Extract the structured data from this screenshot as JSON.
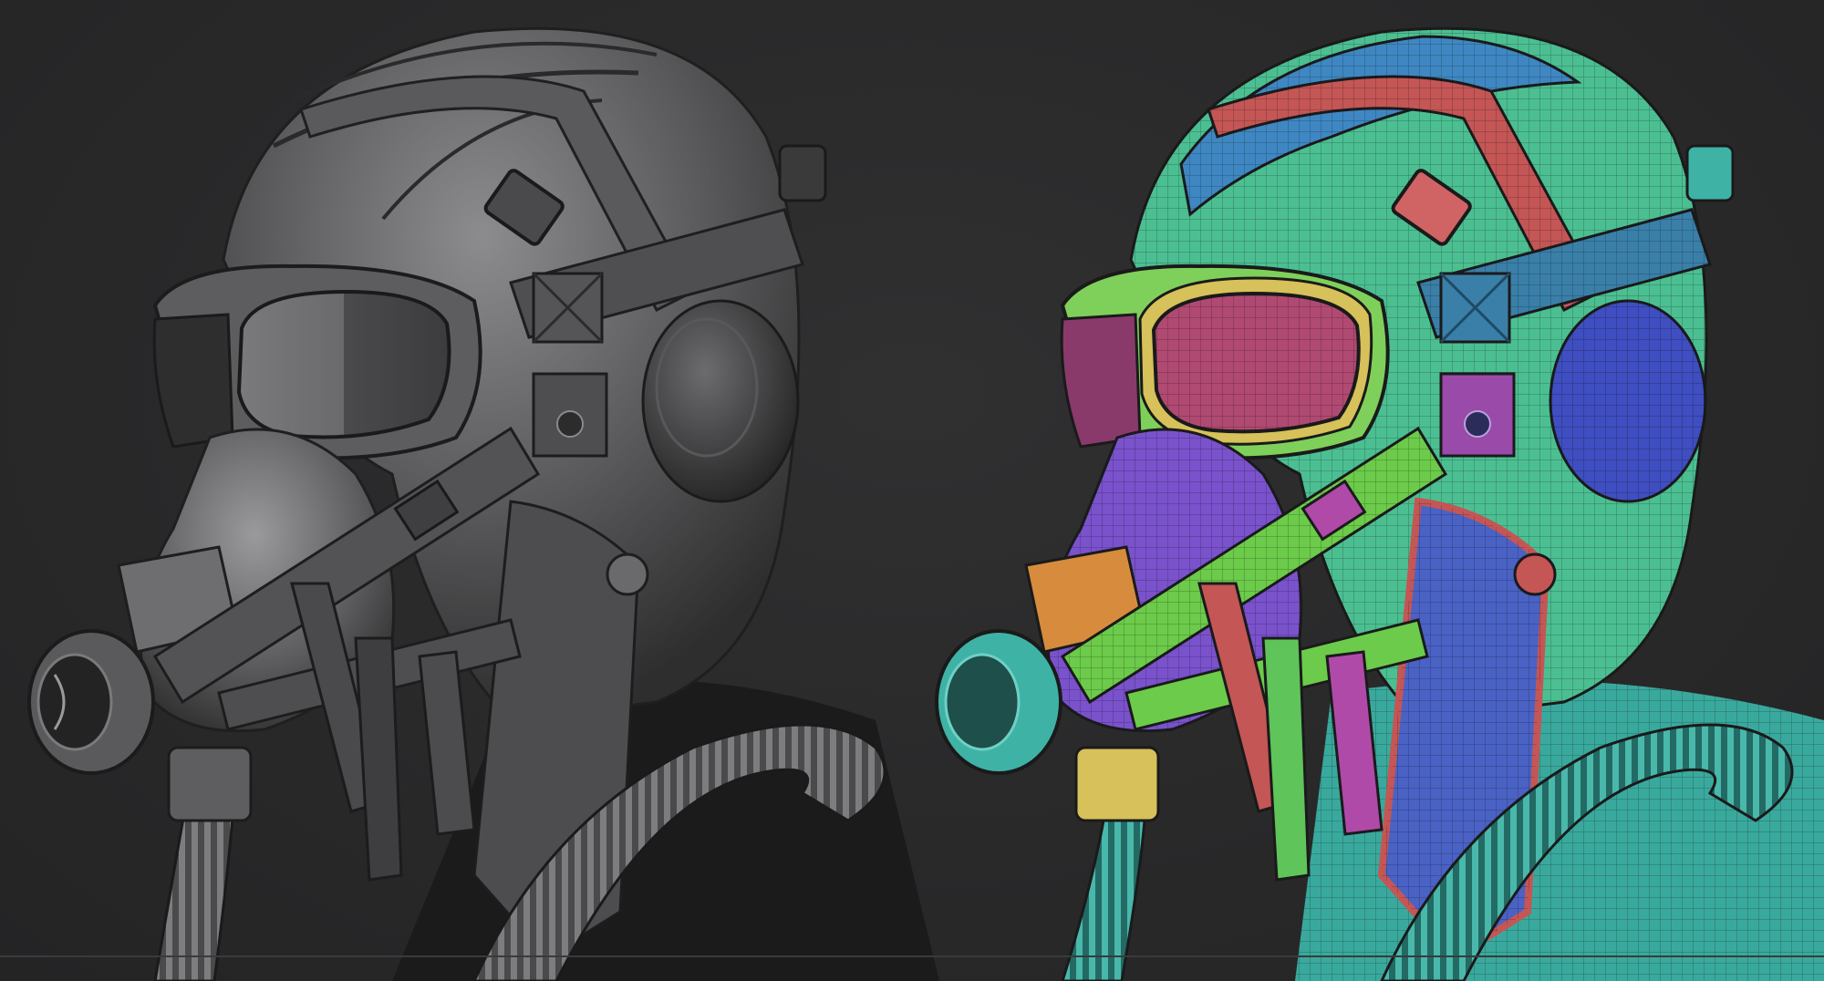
{
  "scene": {
    "background": "#2a2a2b",
    "left_render": {
      "mode": "matcap-gray",
      "subject": "pilot-helmet-gas-mask"
    },
    "right_render": {
      "mode": "polygroups-wireframe",
      "subject": "pilot-helmet-gas-mask"
    }
  },
  "colors": {
    "clay_dark": "#3b3b3c",
    "clay_mid": "#5c5c5e",
    "clay_light": "#8a8a8c",
    "teal": "#3fb2a6",
    "green": "#5fc45a",
    "blue": "#3c7fb8",
    "purple": "#7a4fc4",
    "red": "#c05050",
    "orange": "#d68c3c",
    "yellow": "#d6c15a",
    "magenta": "#b04aa8",
    "navy": "#3f4aa8"
  }
}
